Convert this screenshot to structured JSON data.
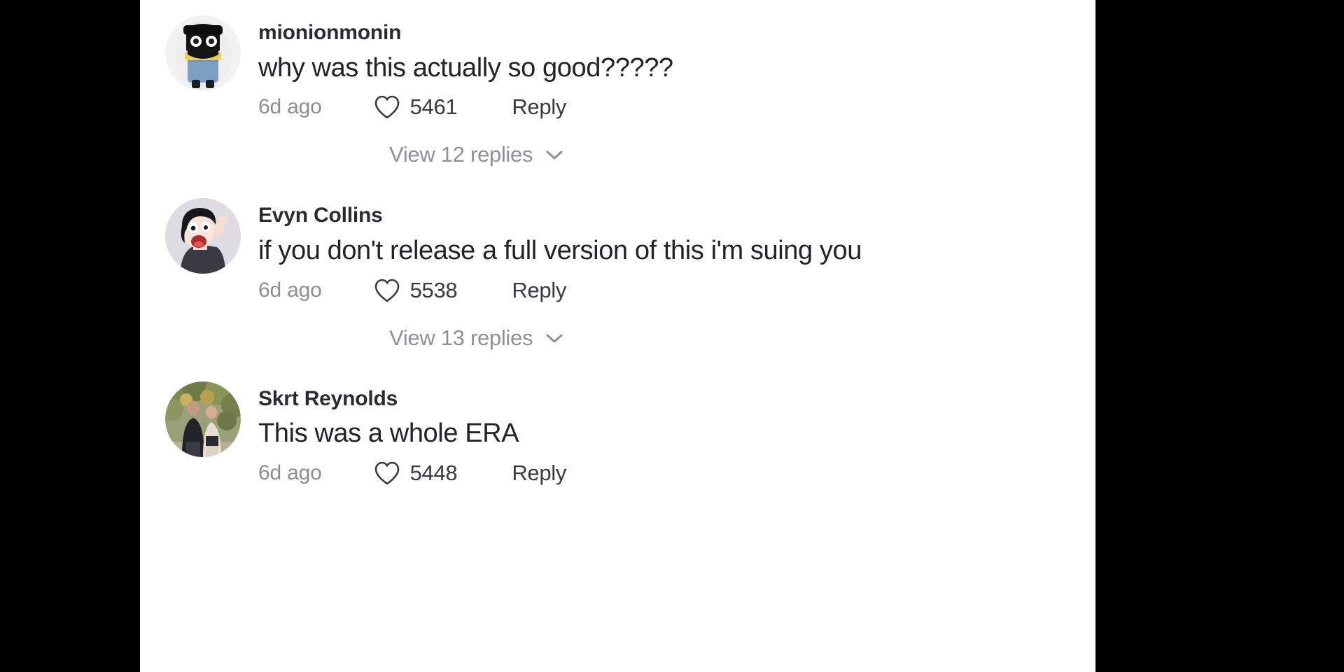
{
  "app": {
    "screen_name": "comment-section",
    "background_color": "#000000",
    "panel_color": "#ffffff",
    "text_color": "#22222b",
    "muted_color": "#8f8f99"
  },
  "comments": [
    {
      "author": "mionionmonin",
      "text": "why was this actually so good?????",
      "timestamp": "6d ago",
      "like_count": "5461",
      "reply_label": "Reply",
      "heart_icon": "heart-icon",
      "avatar_icon": "avatar-minion-figure",
      "replies": {
        "label": "View 12 replies",
        "count": "12",
        "chevron_icon": "chevron-down-icon"
      }
    },
    {
      "author": "Evyn Collins",
      "text": "if you don't release a full version of this i'm suing you",
      "timestamp": "6d ago",
      "like_count": "5538",
      "reply_label": "Reply",
      "heart_icon": "heart-icon",
      "avatar_icon": "avatar-cartoon-person",
      "replies": {
        "label": "View 13 replies",
        "count": "13",
        "chevron_icon": "chevron-down-icon"
      }
    },
    {
      "author": "Skrt Reynolds",
      "text": "This was a whole ERA",
      "timestamp": "6d ago",
      "like_count": "5448",
      "reply_label": "Reply",
      "heart_icon": "heart-icon",
      "avatar_icon": "avatar-photo-couple",
      "replies": null
    }
  ]
}
